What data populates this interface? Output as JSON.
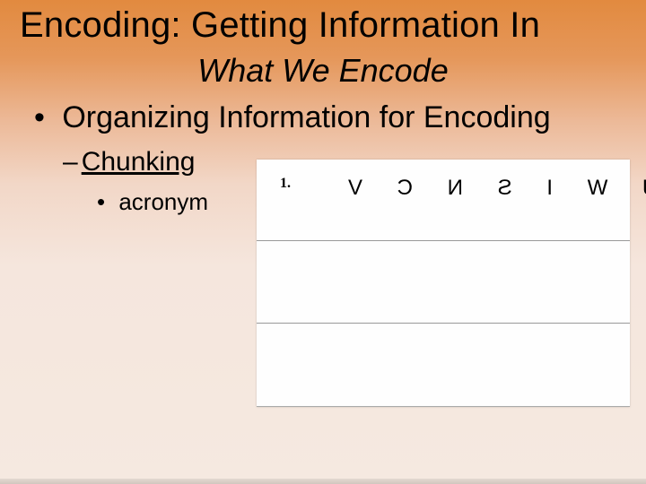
{
  "title": "Encoding: Getting Information In",
  "subtitle": "What We Encode",
  "bullets": {
    "l1": "Organizing Information for Encoding",
    "l2": "Chunking",
    "l3": "acronym"
  },
  "figure": {
    "item_number": "1.",
    "glyph_string": "J W I S N C V"
  }
}
